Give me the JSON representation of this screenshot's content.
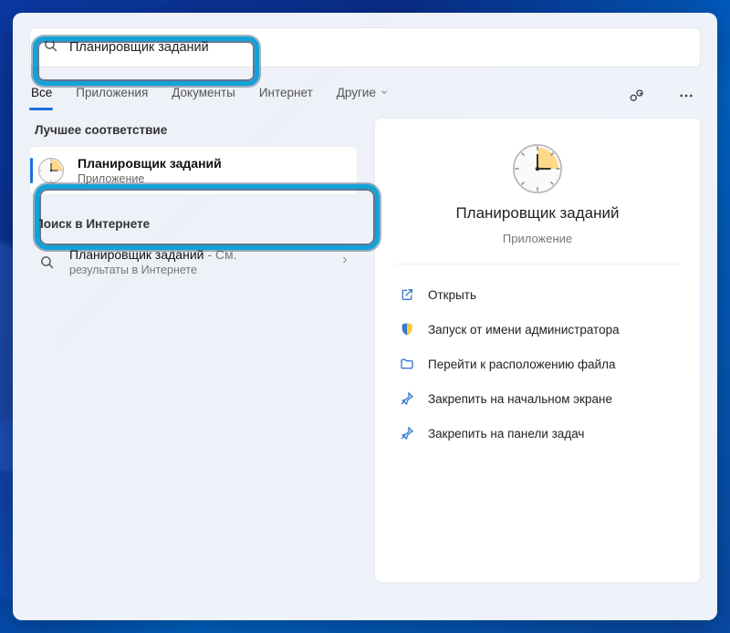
{
  "search": {
    "query": "Планировщик заданий"
  },
  "tabs": {
    "all": "Все",
    "apps": "Приложения",
    "documents": "Документы",
    "internet": "Интернет",
    "more": "Другие"
  },
  "sections": {
    "best_match": "Лучшее соответствие",
    "web_search": "Поиск в Интернете"
  },
  "best_match": {
    "title": "Планировщик заданий",
    "subtitle": "Приложение"
  },
  "web_result": {
    "title_main": "Планировщик заданий",
    "title_suffix": " - См.",
    "subtitle": "результаты в Интернете"
  },
  "preview": {
    "title": "Планировщик заданий",
    "subtitle": "Приложение"
  },
  "actions": {
    "open": "Открыть",
    "run_as_admin": "Запуск от имени администратора",
    "open_file_location": "Перейти к расположению файла",
    "pin_start": "Закрепить на начальном экране",
    "pin_taskbar": "Закрепить на панели задач"
  }
}
